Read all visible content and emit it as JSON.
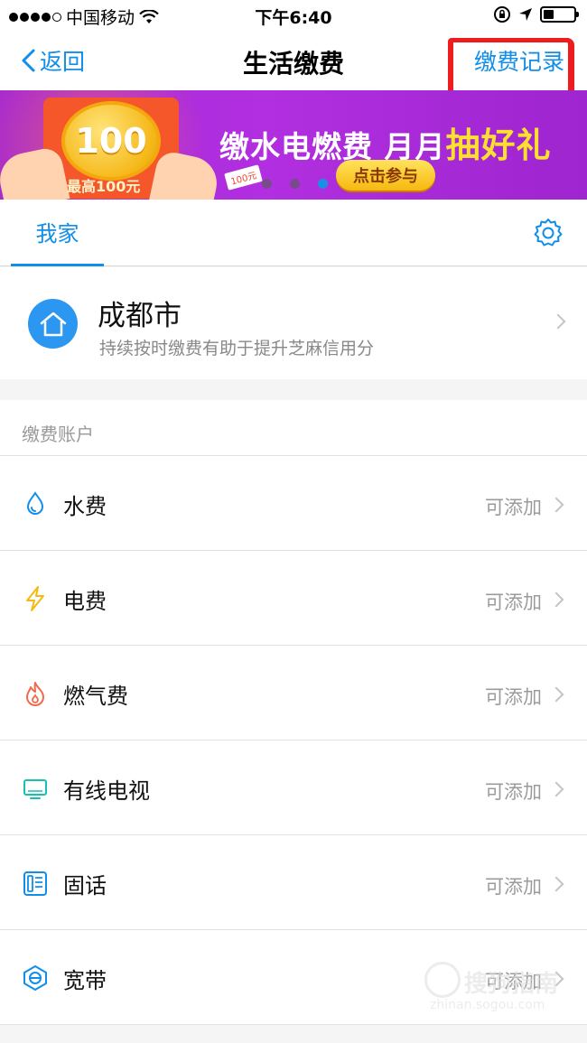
{
  "status_bar": {
    "carrier": "中国移动",
    "time": "下午6:40"
  },
  "nav": {
    "back_label": "返回",
    "title": "生活缴费",
    "record_label": "缴费记录"
  },
  "banner": {
    "coin_amount": "100",
    "coin_caption": "最高100元",
    "headline_main": "缴水电燃费 月月",
    "headline_highlight": "抽好礼",
    "cta_label": "点击参与",
    "tag": "100元",
    "pages": 3,
    "active_page": 3
  },
  "tabs": {
    "home_label": "我家"
  },
  "home": {
    "city": "成都市",
    "hint": "持续按时缴费有助于提升芝麻信用分"
  },
  "accounts": {
    "section_title": "缴费账户",
    "items": [
      {
        "label": "水费",
        "status": "可添加",
        "icon": "water-drop-icon",
        "color": "#108ee9"
      },
      {
        "label": "电费",
        "status": "可添加",
        "icon": "lightning-icon",
        "color": "#f5b90f"
      },
      {
        "label": "燃气费",
        "status": "可添加",
        "icon": "flame-icon",
        "color": "#f26a4b"
      },
      {
        "label": "有线电视",
        "status": "可添加",
        "icon": "tv-icon",
        "color": "#16c1b0"
      },
      {
        "label": "固话",
        "status": "可添加",
        "icon": "telephone-icon",
        "color": "#108ee9"
      },
      {
        "label": "宽带",
        "status": "可添加",
        "icon": "broadband-icon",
        "color": "#108ee9"
      }
    ]
  },
  "watermark": {
    "text": "搜狗指南",
    "url": "zhinan.sogou.com"
  },
  "colors": {
    "accent": "#108ee9",
    "annotation": "#ee1c1c",
    "banner_bg": "#a326d6"
  }
}
